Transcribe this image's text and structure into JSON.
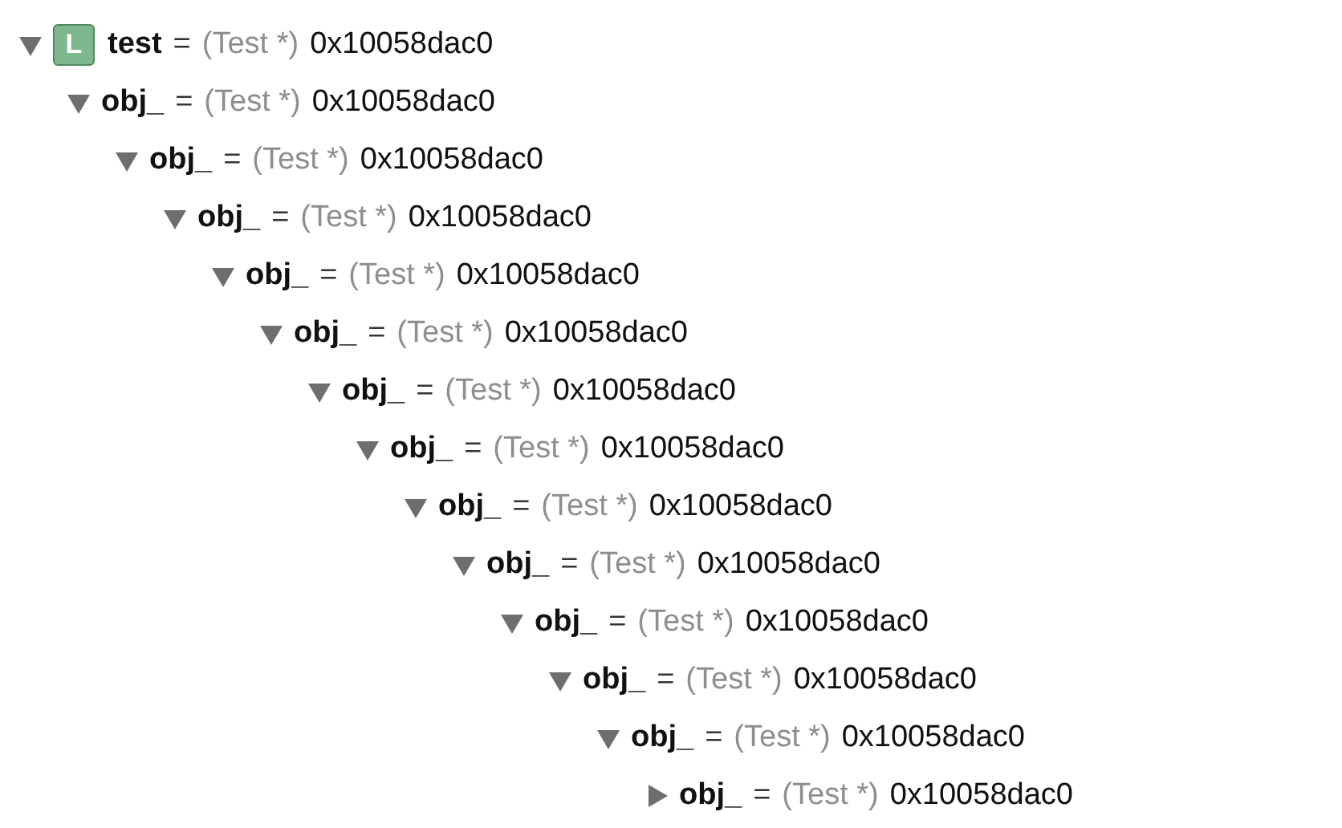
{
  "tree": {
    "name": "test",
    "badge": "L",
    "equals": "=",
    "type": "(Test *)",
    "value": "0x10058dac0",
    "expanded": true,
    "children": [
      {
        "name": "obj_",
        "equals": "=",
        "type": "(Test *)",
        "value": "0x10058dac0",
        "expanded": true,
        "children": [
          {
            "name": "obj_",
            "equals": "=",
            "type": "(Test *)",
            "value": "0x10058dac0",
            "expanded": true,
            "children": [
              {
                "name": "obj_",
                "equals": "=",
                "type": "(Test *)",
                "value": "0x10058dac0",
                "expanded": true,
                "children": [
                  {
                    "name": "obj_",
                    "equals": "=",
                    "type": "(Test *)",
                    "value": "0x10058dac0",
                    "expanded": true,
                    "children": [
                      {
                        "name": "obj_",
                        "equals": "=",
                        "type": "(Test *)",
                        "value": "0x10058dac0",
                        "expanded": true,
                        "children": [
                          {
                            "name": "obj_",
                            "equals": "=",
                            "type": "(Test *)",
                            "value": "0x10058dac0",
                            "expanded": true,
                            "children": [
                              {
                                "name": "obj_",
                                "equals": "=",
                                "type": "(Test *)",
                                "value": "0x10058dac0",
                                "expanded": true,
                                "children": [
                                  {
                                    "name": "obj_",
                                    "equals": "=",
                                    "type": "(Test *)",
                                    "value": "0x10058dac0",
                                    "expanded": true,
                                    "children": [
                                      {
                                        "name": "obj_",
                                        "equals": "=",
                                        "type": "(Test *)",
                                        "value": "0x10058dac0",
                                        "expanded": true,
                                        "children": [
                                          {
                                            "name": "obj_",
                                            "equals": "=",
                                            "type": "(Test *)",
                                            "value": "0x10058dac0",
                                            "expanded": true,
                                            "children": [
                                              {
                                                "name": "obj_",
                                                "equals": "=",
                                                "type": "(Test *)",
                                                "value": "0x10058dac0",
                                                "expanded": true,
                                                "children": [
                                                  {
                                                    "name": "obj_",
                                                    "equals": "=",
                                                    "type": "(Test *)",
                                                    "value": "0x10058dac0",
                                                    "expanded": true,
                                                    "children": [
                                                      {
                                                        "name": "obj_",
                                                        "equals": "=",
                                                        "type": "(Test *)",
                                                        "value": "0x10058dac0",
                                                        "expanded": false
                                                      }
                                                    ]
                                                  }
                                                ]
                                              }
                                            ]
                                          }
                                        ]
                                      }
                                    ]
                                  }
                                ]
                              }
                            ]
                          }
                        ]
                      }
                    ]
                  }
                ]
              }
            ]
          }
        ]
      }
    ]
  }
}
